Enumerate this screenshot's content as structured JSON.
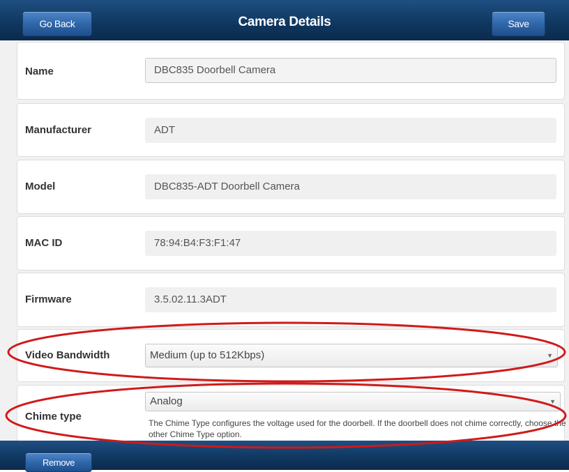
{
  "header": {
    "back_label": "Go Back",
    "title": "Camera Details",
    "save_label": "Save"
  },
  "fields": {
    "name": {
      "label": "Name",
      "value": "DBC835 Doorbell Camera"
    },
    "manufacturer": {
      "label": "Manufacturer",
      "value": "ADT"
    },
    "model": {
      "label": "Model",
      "value": "DBC835-ADT Doorbell Camera"
    },
    "mac": {
      "label": "MAC ID",
      "value": "78:94:B4:F3:F1:47"
    },
    "firmware": {
      "label": "Firmware",
      "value": "3.5.02.11.3ADT"
    },
    "bandwidth": {
      "label": "Video Bandwidth",
      "value": "Medium (up to 512Kbps)"
    },
    "chime": {
      "label": "Chime type",
      "value": "Analog",
      "help": "The Chime Type configures the voltage used for the doorbell. If the doorbell does not chime correctly, choose the other Chime Type option."
    }
  },
  "footer": {
    "remove_label": "Remove"
  },
  "icons": {
    "dropdown": "chevron-down-icon"
  },
  "colors": {
    "header_bg": "#103862",
    "button_bg": "#2f67ab",
    "highlight_oval": "#d01a1a"
  }
}
